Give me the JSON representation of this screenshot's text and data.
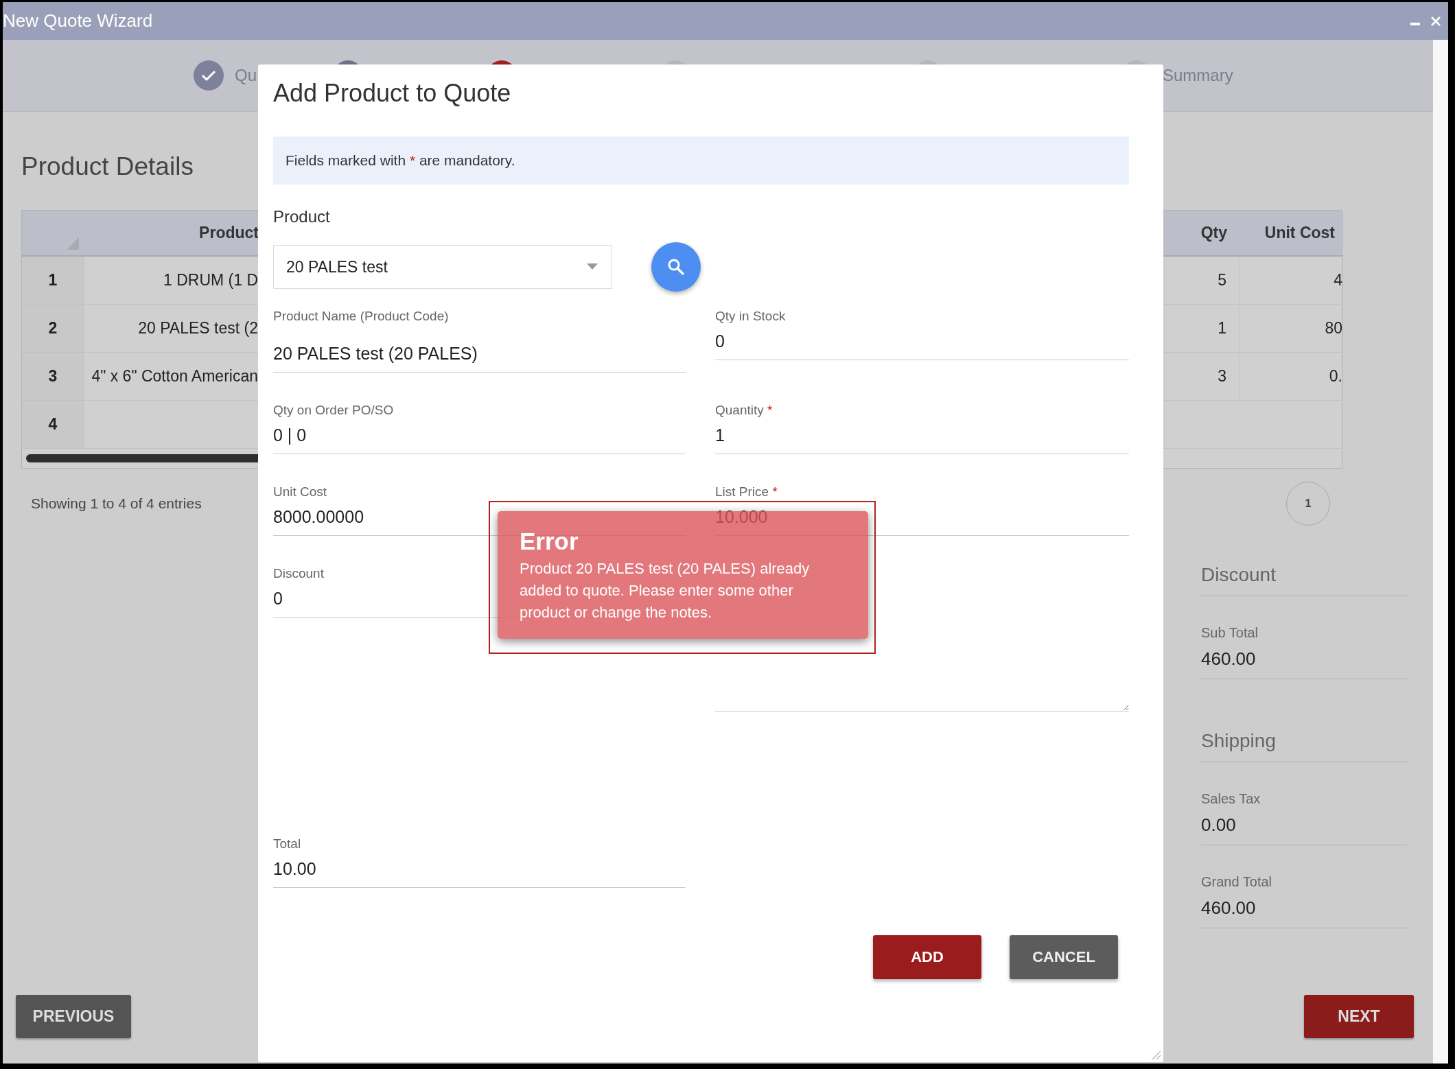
{
  "window": {
    "title": "New Quote Wizard"
  },
  "steps": [
    {
      "label": "Qu",
      "kind": "done"
    },
    {
      "kind": "visited"
    },
    {
      "kind": "current"
    },
    {
      "kind": "pending"
    },
    {
      "kind": "pending"
    },
    {
      "label": "Summary",
      "kind": "pending"
    }
  ],
  "product_details": {
    "title": "Product Details",
    "table": {
      "columns": [
        "Product",
        "Qty",
        "Unit Cost"
      ],
      "rows": [
        {
          "number": "1",
          "product": "1 DRUM (1 D",
          "qty": "5",
          "unit_cost": "4"
        },
        {
          "number": "2",
          "product": "20 PALES test (2",
          "qty": "1",
          "unit_cost": "80"
        },
        {
          "number": "3",
          "product": "4\" x 6\" Cotton American",
          "qty": "3",
          "unit_cost": "0."
        },
        {
          "number": "4"
        }
      ]
    },
    "entries_info": "Showing 1 to 4 of 4 entries",
    "pages": [
      {
        "label": "1",
        "selected": true
      }
    ]
  },
  "summary": [
    {
      "kind": "heading",
      "label": "Discount"
    },
    {
      "kind": "field",
      "label": "Sub Total",
      "value": "460.00"
    },
    {
      "kind": "heading",
      "label": "Shipping"
    },
    {
      "kind": "field",
      "label": "Sales Tax",
      "value": "0.00"
    },
    {
      "kind": "field",
      "label": "Grand Total",
      "value": "460.00"
    }
  ],
  "nav_buttons": [
    {
      "label": "PREVIOUS",
      "kind": "previous"
    },
    {
      "label": "NEXT",
      "kind": "next"
    }
  ],
  "dialog": {
    "title": "Add Product to Quote",
    "notice": {
      "before": "Fields marked with",
      "mark": "*",
      "after": "are mandatory."
    },
    "product": {
      "label": "Product",
      "value": "20 PALES test"
    },
    "fields": [
      {
        "kind": "text",
        "label": "Product Name (Product Code)",
        "value": "20 PALES test (20 PALES)"
      },
      {
        "kind": "text",
        "label": "Qty in Stock",
        "value": "0"
      },
      {
        "kind": "text",
        "label": "Qty on Order PO/SO",
        "value": "0 | 0"
      },
      {
        "kind": "text",
        "label": "Quantity",
        "required_mark": "*",
        "value": "1"
      },
      {
        "kind": "text",
        "label": "Unit Cost",
        "value": "8000.00000"
      },
      {
        "kind": "text",
        "label": "List Price",
        "required_mark": "*",
        "value": "10.000"
      },
      {
        "kind": "text",
        "label": "Discount",
        "value": "0"
      },
      {
        "kind": "textarea"
      },
      {
        "kind": "text",
        "label": "Total",
        "value": "10.00"
      }
    ],
    "buttons": [
      {
        "label": "ADD",
        "kind": "primary"
      },
      {
        "label": "CANCEL",
        "kind": "secondary"
      }
    ],
    "error": {
      "title": "Error",
      "message": "Product 20 PALES test (20 PALES) already added to quote. Please enter some other product or change the notes.",
      "highlighted": true
    }
  }
}
